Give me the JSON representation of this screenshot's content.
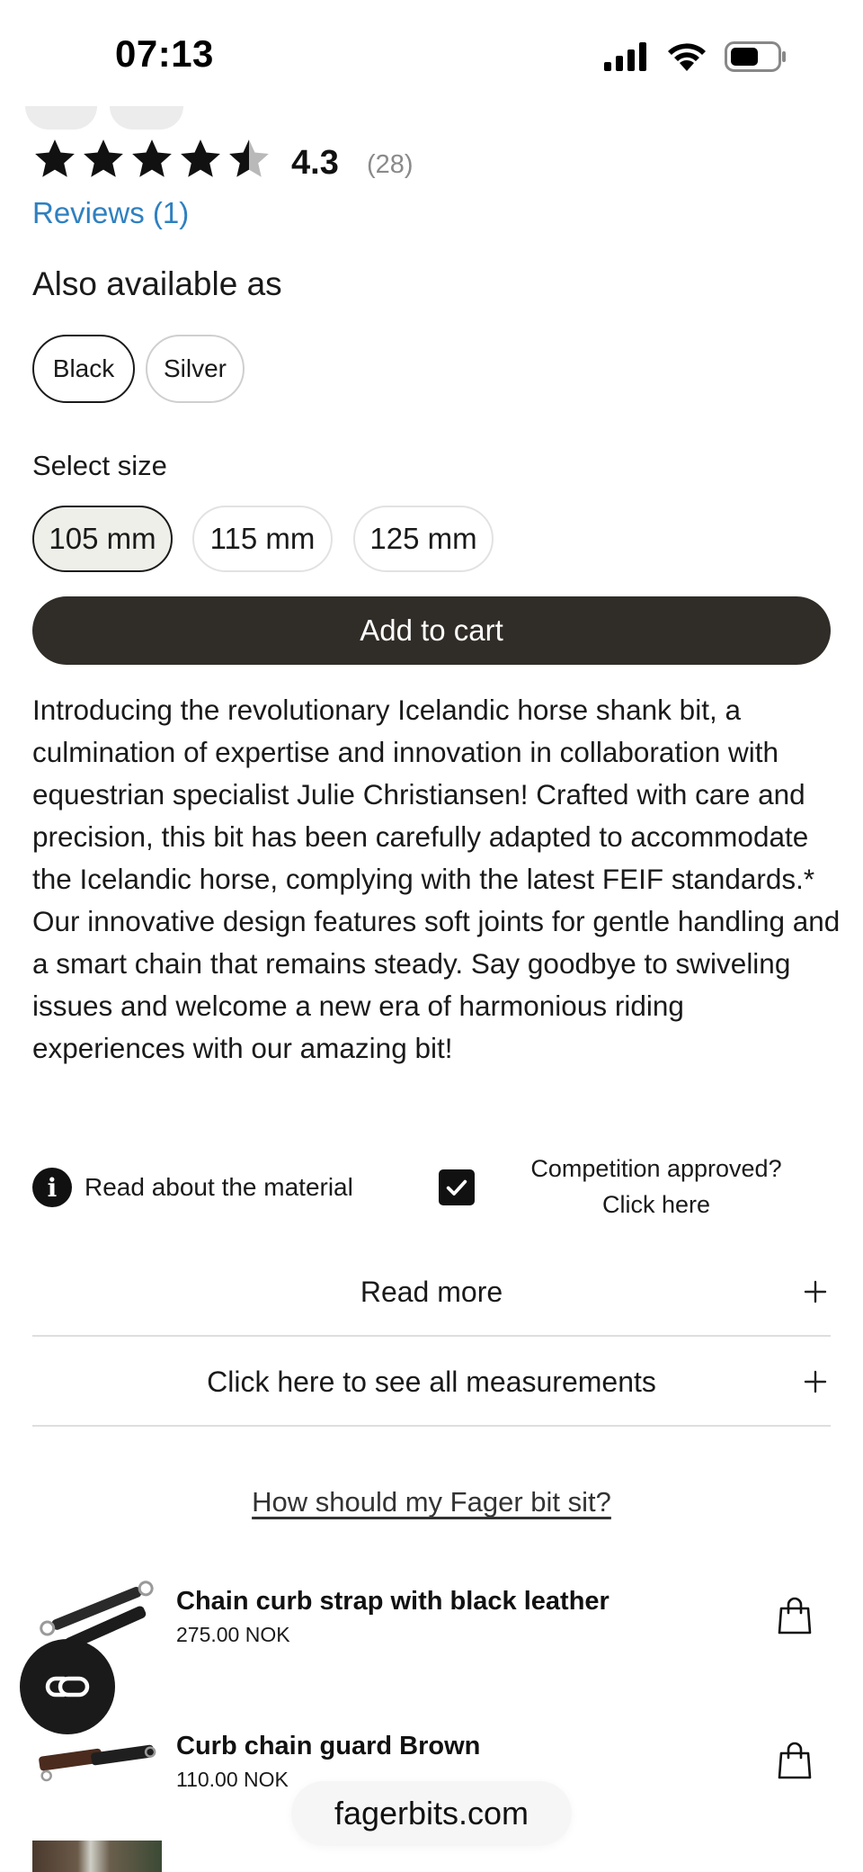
{
  "status_bar": {
    "time": "07:13"
  },
  "rating": {
    "value": "4.3",
    "stars": 4.3,
    "count": "(28)",
    "reviews_link": "Reviews (1)"
  },
  "variants": {
    "title": "Also available as",
    "options": [
      "Black",
      "Silver"
    ],
    "selected": "Black"
  },
  "size": {
    "title": "Select size",
    "options": [
      "105 mm",
      "115 mm",
      "125 mm"
    ],
    "selected": "105 mm"
  },
  "cart": {
    "add_label": "Add to cart"
  },
  "description": {
    "p1": "Introducing the revolutionary Icelandic horse shank bit, a culmination of expertise and innovation in collaboration with equestrian specialist Julie Christiansen! Crafted with care and precision, this bit has been carefully adapted to accommodate the Icelandic horse, complying with the latest FEIF standards.*",
    "p2": "Our innovative design features soft joints for gentle handling and a smart chain that remains steady. Say goodbye to swiveling issues and welcome a new era of harmonious riding experiences with our amazing bit!"
  },
  "info": {
    "material_label": "Read about the material",
    "competition_line1": "Competition approved?",
    "competition_line2": "Click here"
  },
  "accordions": [
    {
      "label": "Read more"
    },
    {
      "label": "Click here to see all measurements"
    }
  ],
  "how_link": "How should my Fager bit sit?",
  "products": [
    {
      "name": "Chain curb strap with black leather",
      "price": "275.00 NOK",
      "icon": "shopping-bag-icon"
    },
    {
      "name": "Curb chain guard Brown",
      "price": "110.00 NOK",
      "icon": "shopping-bag-icon"
    }
  ],
  "browser": {
    "domain": "fagerbits.com"
  },
  "colors": {
    "primary_button": "#302c27",
    "link": "#2f80c0",
    "selected_size_bg": "#efefea"
  }
}
